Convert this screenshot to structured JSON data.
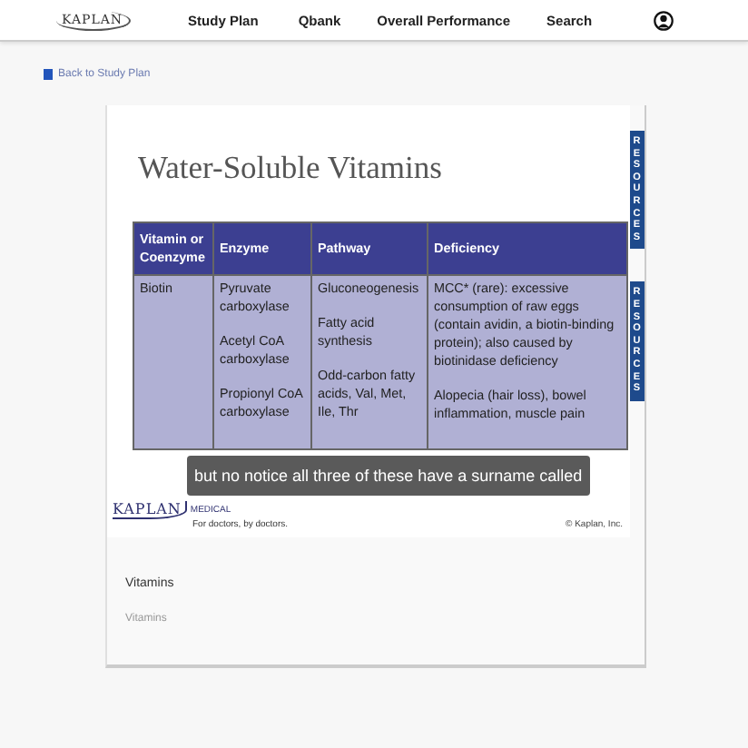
{
  "nav": {
    "logo": "KAPLAN",
    "items": [
      "Study Plan",
      "Qbank",
      "Overall Performance",
      "Search"
    ]
  },
  "back_link": "Back to Study Plan",
  "slide": {
    "title": "Water-Soluble Vitamins",
    "table": {
      "columns": [
        "Vitamin or Coenzyme",
        "Enzyme",
        "Pathway",
        "Deficiency"
      ],
      "rows": [
        [
          [
            "Biotin"
          ],
          [
            "Pyruvate carboxylase",
            "Acetyl CoA carboxylase",
            "Propionyl CoA carboxylase"
          ],
          [
            "Gluconeogenesis",
            "Fatty acid synthesis",
            "Odd-carbon fatty acids, Val, Met, Ile, Thr"
          ],
          [
            "MCC* (rare): excessive consumption of raw eggs (contain avidin, a biotin-binding protein); also caused by biotinidase deficiency",
            "Alopecia (hair loss), bowel inflammation, muscle pain"
          ]
        ]
      ]
    },
    "caption": "but no notice all three of these have a surname called",
    "footer": {
      "logo": "KAPLAN",
      "logo_suffix": "MEDICAL",
      "tagline": "For doctors, by doctors.",
      "copyright": "© Kaplan, Inc."
    },
    "side_tabs": [
      "RESOURCES",
      "RESOURCES"
    ]
  },
  "section": {
    "title": "Vitamins",
    "subtitle": "Vitamins"
  }
}
